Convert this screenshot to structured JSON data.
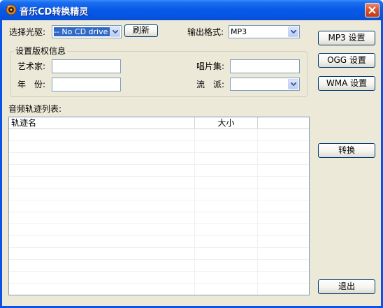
{
  "window": {
    "title": "音乐CD转换精灵",
    "icon": "music-cd-icon",
    "close_icon": "close-icon"
  },
  "drive": {
    "label": "选择光驱:",
    "selected": "-- No CD drive --",
    "refresh_label": "刷新"
  },
  "format": {
    "label": "输出格式:",
    "selected": "MP3"
  },
  "copyright": {
    "group_label": "设置版权信息",
    "artist_label": "艺术家:",
    "artist_value": "",
    "year_label": "年　份:",
    "year_value": "",
    "album_label": "唱片集:",
    "album_value": "",
    "genre_label": "流　派:",
    "genre_value": ""
  },
  "tracks": {
    "label": "音频轨迹列表:",
    "columns": [
      "轨迹名",
      "大小",
      ""
    ]
  },
  "side_buttons": {
    "mp3": "MP3 设置",
    "ogg": "OGG 设置",
    "wma": "WMA 设置",
    "convert": "转换",
    "exit": "退出"
  }
}
